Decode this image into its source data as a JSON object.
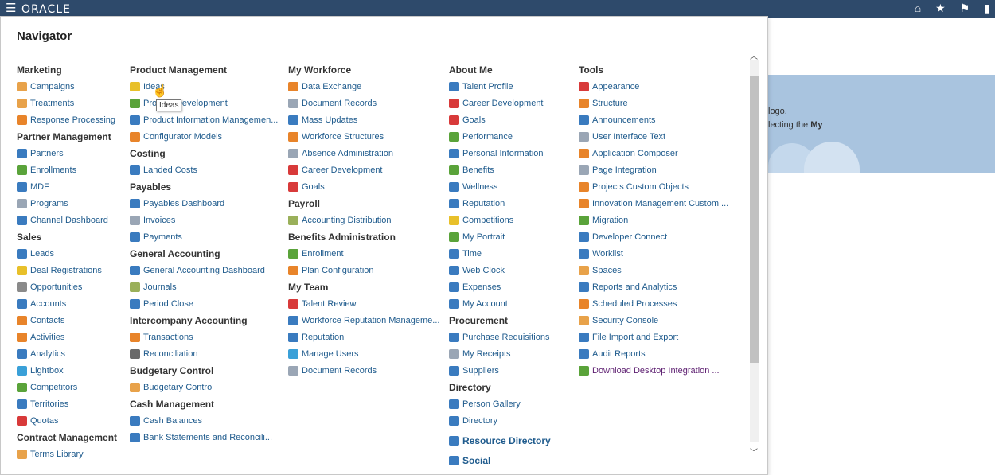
{
  "topbar": {
    "logo": "ORACLE",
    "menu_icon": "hamburger-icon",
    "icons": [
      "home-icon",
      "star-icon",
      "flag-icon",
      "chat-icon"
    ]
  },
  "background": {
    "line1": "logo.",
    "line2_pre": "lecting the ",
    "line2_bold": "My"
  },
  "navigator": {
    "title": "Navigator"
  },
  "tooltip": "Ideas",
  "columns": [
    {
      "groups": [
        {
          "heading": "Marketing",
          "items": [
            {
              "label": "Campaigns",
              "icon": "campaigns-icon",
              "color": "#e8a24a"
            },
            {
              "label": "Treatments",
              "icon": "treatments-icon",
              "color": "#e8a24a"
            },
            {
              "label": "Response Processing",
              "icon": "response-icon",
              "color": "#e8842a"
            }
          ]
        },
        {
          "heading": "Partner Management",
          "items": [
            {
              "label": "Partners",
              "icon": "handshake-icon",
              "color": "#3a7bbf"
            },
            {
              "label": "Enrollments",
              "icon": "enrollments-icon",
              "color": "#5aa33a"
            },
            {
              "label": "MDF",
              "icon": "mdf-icon",
              "color": "#3a7bbf"
            },
            {
              "label": "Programs",
              "icon": "programs-icon",
              "color": "#9aa6b5"
            },
            {
              "label": "Channel Dashboard",
              "icon": "dashboard-icon",
              "color": "#3a7bbf"
            }
          ]
        },
        {
          "heading": "Sales",
          "items": [
            {
              "label": "Leads",
              "icon": "leads-icon",
              "color": "#3a7bbf"
            },
            {
              "label": "Deal Registrations",
              "icon": "deal-icon",
              "color": "#e8c02a"
            },
            {
              "label": "Opportunities",
              "icon": "opportunities-icon",
              "color": "#8a8a8a"
            },
            {
              "label": "Accounts",
              "icon": "accounts-icon",
              "color": "#3a7bbf"
            },
            {
              "label": "Contacts",
              "icon": "contacts-icon",
              "color": "#e8842a"
            },
            {
              "label": "Activities",
              "icon": "activities-icon",
              "color": "#e8842a"
            },
            {
              "label": "Analytics",
              "icon": "analytics-icon",
              "color": "#3a7bbf"
            },
            {
              "label": "Lightbox",
              "icon": "lightbox-icon",
              "color": "#3aa0d8"
            },
            {
              "label": "Competitors",
              "icon": "competitors-icon",
              "color": "#5aa33a"
            },
            {
              "label": "Territories",
              "icon": "territories-icon",
              "color": "#3a7bbf"
            },
            {
              "label": "Quotas",
              "icon": "quotas-icon",
              "color": "#d83a3a"
            }
          ]
        },
        {
          "heading": "Contract Management",
          "items": [
            {
              "label": "Terms Library",
              "icon": "terms-icon",
              "color": "#e8a24a"
            }
          ]
        }
      ]
    },
    {
      "groups": [
        {
          "heading": "Product Management",
          "items": [
            {
              "label": "Ideas",
              "icon": "lightbulb-icon",
              "color": "#e8c02a"
            },
            {
              "label": "Product Development",
              "icon": "product-dev-icon",
              "color": "#5aa33a"
            },
            {
              "label": "Product Information Managemen...",
              "icon": "barcode-icon",
              "color": "#3a7bbf"
            },
            {
              "label": "Configurator Models",
              "icon": "tools-icon",
              "color": "#e8842a"
            }
          ]
        },
        {
          "heading": "Costing",
          "items": [
            {
              "label": "Landed Costs",
              "icon": "landed-costs-icon",
              "color": "#3a7bbf"
            }
          ]
        },
        {
          "heading": "Payables",
          "items": [
            {
              "label": "Payables Dashboard",
              "icon": "dashboard-icon",
              "color": "#3a7bbf"
            },
            {
              "label": "Invoices",
              "icon": "invoices-icon",
              "color": "#9aa6b5"
            },
            {
              "label": "Payments",
              "icon": "payments-icon",
              "color": "#3a7bbf"
            }
          ]
        },
        {
          "heading": "General Accounting",
          "items": [
            {
              "label": "General Accounting Dashboard",
              "icon": "dashboard-icon",
              "color": "#3a7bbf"
            },
            {
              "label": "Journals",
              "icon": "journals-icon",
              "color": "#9ab05a"
            },
            {
              "label": "Period Close",
              "icon": "period-close-icon",
              "color": "#3a7bbf"
            }
          ]
        },
        {
          "heading": "Intercompany Accounting",
          "items": [
            {
              "label": "Transactions",
              "icon": "transactions-icon",
              "color": "#e8842a"
            },
            {
              "label": "Reconciliation",
              "icon": "reconciliation-icon",
              "color": "#6a6a6a"
            }
          ]
        },
        {
          "heading": "Budgetary Control",
          "items": [
            {
              "label": "Budgetary Control",
              "icon": "budgetary-icon",
              "color": "#e8a24a"
            }
          ]
        },
        {
          "heading": "Cash Management",
          "items": [
            {
              "label": "Cash Balances",
              "icon": "bank-icon",
              "color": "#3a7bbf"
            },
            {
              "label": "Bank Statements and Reconcili...",
              "icon": "bank-statements-icon",
              "color": "#3a7bbf"
            }
          ]
        }
      ]
    },
    {
      "groups": [
        {
          "heading": "My Workforce",
          "items": [
            {
              "label": "Data Exchange",
              "icon": "exchange-icon",
              "color": "#e8842a"
            },
            {
              "label": "Document Records",
              "icon": "document-icon",
              "color": "#9aa6b5"
            },
            {
              "label": "Mass Updates",
              "icon": "mass-updates-icon",
              "color": "#3a7bbf"
            },
            {
              "label": "Workforce Structures",
              "icon": "structures-icon",
              "color": "#e8842a"
            },
            {
              "label": "Absence Administration",
              "icon": "absence-icon",
              "color": "#9aa6b5"
            },
            {
              "label": "Career Development",
              "icon": "career-icon",
              "color": "#d83a3a"
            },
            {
              "label": "Goals",
              "icon": "goals-icon",
              "color": "#d83a3a"
            }
          ]
        },
        {
          "heading": "Payroll",
          "items": [
            {
              "label": "Accounting Distribution",
              "icon": "distribution-icon",
              "color": "#9ab05a"
            }
          ]
        },
        {
          "heading": "Benefits Administration",
          "items": [
            {
              "label": "Enrollment",
              "icon": "enrollment-icon",
              "color": "#5aa33a"
            },
            {
              "label": "Plan Configuration",
              "icon": "tools-icon",
              "color": "#e8842a"
            }
          ]
        },
        {
          "heading": "My Team",
          "items": [
            {
              "label": "Talent Review",
              "icon": "talent-review-icon",
              "color": "#d83a3a"
            },
            {
              "label": "Workforce Reputation Manageme...",
              "icon": "reputation-mgmt-icon",
              "color": "#3a7bbf"
            },
            {
              "label": "Reputation",
              "icon": "reputation-icon",
              "color": "#3a7bbf"
            },
            {
              "label": "Manage Users",
              "icon": "users-icon",
              "color": "#3aa0d8"
            },
            {
              "label": "Document Records",
              "icon": "document-icon",
              "color": "#9aa6b5"
            }
          ]
        }
      ]
    },
    {
      "groups": [
        {
          "heading": "About Me",
          "items": [
            {
              "label": "Talent Profile",
              "icon": "person-icon",
              "color": "#3a7bbf"
            },
            {
              "label": "Career Development",
              "icon": "career-icon",
              "color": "#d83a3a"
            },
            {
              "label": "Goals",
              "icon": "goals-icon",
              "color": "#d83a3a"
            },
            {
              "label": "Performance",
              "icon": "performance-icon",
              "color": "#5aa33a"
            },
            {
              "label": "Personal Information",
              "icon": "person-icon",
              "color": "#3a7bbf"
            },
            {
              "label": "Benefits",
              "icon": "benefits-icon",
              "color": "#5aa33a"
            },
            {
              "label": "Wellness",
              "icon": "wellness-icon",
              "color": "#3a7bbf"
            },
            {
              "label": "Reputation",
              "icon": "reputation-icon",
              "color": "#3a7bbf"
            },
            {
              "label": "Competitions",
              "icon": "trophy-icon",
              "color": "#e8c02a"
            },
            {
              "label": "My Portrait",
              "icon": "portrait-icon",
              "color": "#5aa33a"
            },
            {
              "label": "Time",
              "icon": "calendar-icon",
              "color": "#3a7bbf"
            },
            {
              "label": "Web Clock",
              "icon": "clock-icon",
              "color": "#3a7bbf"
            },
            {
              "label": "Expenses",
              "icon": "expenses-icon",
              "color": "#3a7bbf"
            },
            {
              "label": "My Account",
              "icon": "account-icon",
              "color": "#3a7bbf"
            }
          ]
        },
        {
          "heading": "Procurement",
          "items": [
            {
              "label": "Purchase Requisitions",
              "icon": "cart-icon",
              "color": "#3a7bbf"
            },
            {
              "label": "My Receipts",
              "icon": "receipts-icon",
              "color": "#9aa6b5"
            },
            {
              "label": "Suppliers",
              "icon": "suppliers-icon",
              "color": "#3a7bbf"
            }
          ]
        },
        {
          "heading": "Directory",
          "items": [
            {
              "label": "Person Gallery",
              "icon": "org-chart-icon",
              "color": "#3a7bbf"
            },
            {
              "label": "Directory",
              "icon": "org-chart-icon",
              "color": "#3a7bbf"
            }
          ]
        }
      ],
      "big_items": [
        {
          "label": "Resource Directory",
          "icon": "resource-directory-icon",
          "color": "#3a7bbf"
        },
        {
          "label": "Social",
          "icon": "social-icon",
          "color": "#3a7bbf"
        }
      ]
    },
    {
      "groups": [
        {
          "heading": "Tools",
          "items": [
            {
              "label": "Appearance",
              "icon": "brush-icon",
              "color": "#d83a3a"
            },
            {
              "label": "Structure",
              "icon": "structure-icon",
              "color": "#e8842a"
            },
            {
              "label": "Announcements",
              "icon": "megaphone-icon",
              "color": "#3a7bbf"
            },
            {
              "label": "User Interface Text",
              "icon": "text-icon",
              "color": "#9aa6b5"
            },
            {
              "label": "Application Composer",
              "icon": "tools-icon",
              "color": "#e8842a"
            },
            {
              "label": "Page Integration",
              "icon": "page-icon",
              "color": "#9aa6b5"
            },
            {
              "label": "Projects Custom Objects",
              "icon": "tools-icon",
              "color": "#e8842a"
            },
            {
              "label": "Innovation Management Custom ...",
              "icon": "tools-icon",
              "color": "#e8842a"
            },
            {
              "label": "Migration",
              "icon": "migration-icon",
              "color": "#5aa33a"
            },
            {
              "label": "Developer Connect",
              "icon": "developer-icon",
              "color": "#3a7bbf"
            },
            {
              "label": "Worklist",
              "icon": "worklist-icon",
              "color": "#3a7bbf"
            },
            {
              "label": "Spaces",
              "icon": "spaces-icon",
              "color": "#e8a24a"
            },
            {
              "label": "Reports and Analytics",
              "icon": "reports-icon",
              "color": "#3a7bbf"
            },
            {
              "label": "Scheduled Processes",
              "icon": "scheduled-icon",
              "color": "#e8842a"
            },
            {
              "label": "Security Console",
              "icon": "shield-icon",
              "color": "#e8a24a"
            },
            {
              "label": "File Import and Export",
              "icon": "import-export-icon",
              "color": "#3a7bbf"
            },
            {
              "label": "Audit Reports",
              "icon": "audit-icon",
              "color": "#3a7bbf"
            },
            {
              "label": "Download Desktop Integration ...",
              "icon": "download-icon",
              "color": "#5aa33a",
              "purple": true
            }
          ]
        }
      ]
    }
  ]
}
